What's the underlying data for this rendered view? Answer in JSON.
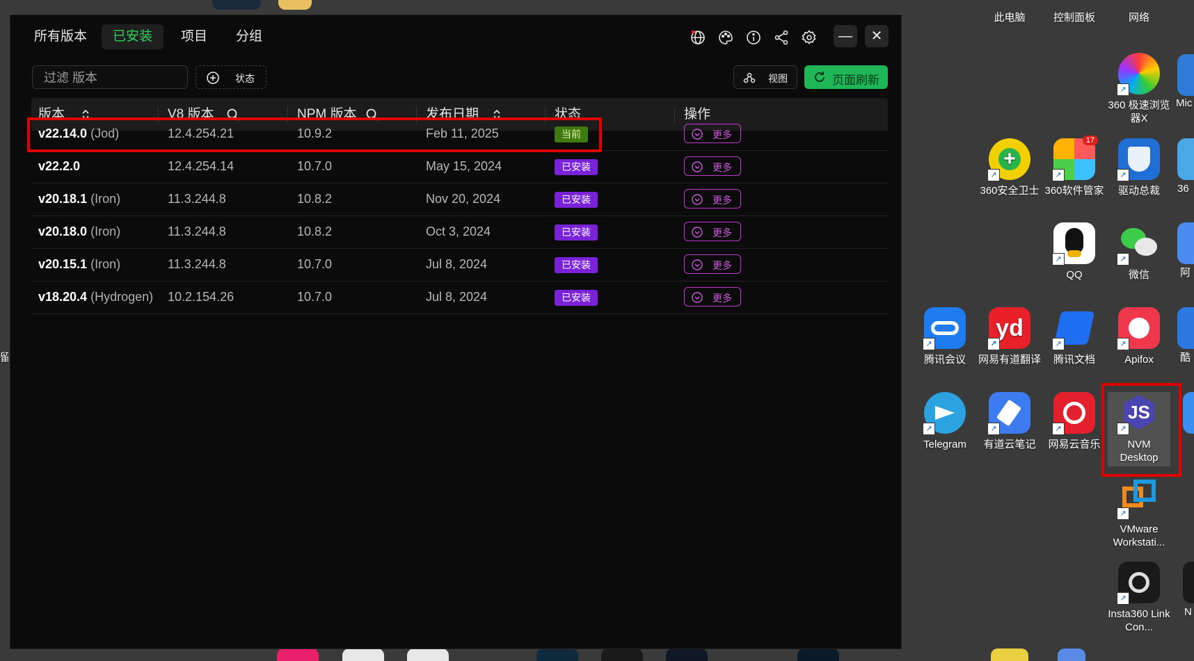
{
  "desktop": {
    "icons": [
      {
        "label": "此电脑"
      },
      {
        "label": "控制面板"
      },
      {
        "label": "网络"
      },
      {
        "label": "360 极速浏览器X"
      },
      {
        "label": "360安全卫士"
      },
      {
        "label": "360软件管家"
      },
      {
        "label": "驱动总裁"
      },
      {
        "label": "QQ"
      },
      {
        "label": "微信"
      },
      {
        "label": "腾讯会议"
      },
      {
        "label": "网易有道翻译"
      },
      {
        "label": "腾讯文档"
      },
      {
        "label": "Apifox"
      },
      {
        "label": "Telegram"
      },
      {
        "label": "有道云笔记"
      },
      {
        "label": "网易云音乐"
      },
      {
        "label": "NVM Desktop"
      },
      {
        "label": "VMware Workstati..."
      },
      {
        "label": "Insta360 Link Con..."
      }
    ],
    "partial_labels": [
      "Mic",
      "阿",
      "酷",
      "N",
      "36",
      "留"
    ],
    "badge_count": "17"
  },
  "app": {
    "tabs": [
      {
        "label": "所有版本"
      },
      {
        "label": "已安装"
      },
      {
        "label": "项目"
      },
      {
        "label": "分组"
      }
    ],
    "filter_placeholder": "过滤 版本",
    "status_button": "状态",
    "view_button": "视图",
    "refresh_button": "页面刷新",
    "columns": [
      "版本",
      "V8 版本",
      "NPM 版本",
      "发布日期",
      "状态",
      "操作"
    ],
    "rows": [
      {
        "version": "v22.14.0",
        "codename": "(Jod)",
        "v8": "12.4.254.21",
        "npm": "10.9.2",
        "date": "Feb 11, 2025",
        "status": "当前",
        "action": "更多"
      },
      {
        "version": "v22.2.0",
        "codename": "",
        "v8": "12.4.254.14",
        "npm": "10.7.0",
        "date": "May 15, 2024",
        "status": "已安装",
        "action": "更多"
      },
      {
        "version": "v20.18.1",
        "codename": "(Iron)",
        "v8": "11.3.244.8",
        "npm": "10.8.2",
        "date": "Nov 20, 2024",
        "status": "已安装",
        "action": "更多"
      },
      {
        "version": "v20.18.0",
        "codename": "(Iron)",
        "v8": "11.3.244.8",
        "npm": "10.8.2",
        "date": "Oct 3, 2024",
        "status": "已安装",
        "action": "更多"
      },
      {
        "version": "v20.15.1",
        "codename": "(Iron)",
        "v8": "11.3.244.8",
        "npm": "10.7.0",
        "date": "Jul 8, 2024",
        "status": "已安装",
        "action": "更多"
      },
      {
        "version": "v18.20.4",
        "codename": "(Hydrogen)",
        "v8": "10.2.154.26",
        "npm": "10.7.0",
        "date": "Jul 8, 2024",
        "status": "已安装",
        "action": "更多"
      }
    ]
  },
  "colors": {
    "accent_green": "#31d25c",
    "refresh_green": "#1eb656",
    "current_badge": "#3f7a10",
    "installed_badge": "#7a22d8",
    "more_border": "#c03bd0",
    "highlight_red": "#e00000"
  },
  "icons": [
    "translate-icon",
    "palette-icon",
    "info-icon",
    "share-icon",
    "settings-icon",
    "minimize-icon",
    "close-icon",
    "plus-circle-icon",
    "view-icon",
    "refresh-icon",
    "sort-icon",
    "search-icon",
    "chevron-down-circle-icon"
  ]
}
